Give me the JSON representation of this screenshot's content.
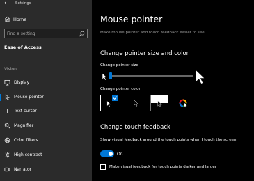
{
  "window": {
    "title": "Settings"
  },
  "sidebar": {
    "home_label": "Home",
    "search_placeholder": "Find a setting",
    "category": "Ease of Access",
    "section": "Vision",
    "items": [
      {
        "label": "Display",
        "icon": "monitor-icon"
      },
      {
        "label": "Mouse pointer",
        "icon": "mouse-pointer-icon",
        "selected": true
      },
      {
        "label": "Text cursor",
        "icon": "text-cursor-icon"
      },
      {
        "label": "Magnifier",
        "icon": "magnifier-icon"
      },
      {
        "label": "Color filters",
        "icon": "color-filters-icon"
      },
      {
        "label": "High contrast",
        "icon": "high-contrast-icon"
      },
      {
        "label": "Narrator",
        "icon": "narrator-icon"
      }
    ]
  },
  "main": {
    "title": "Mouse pointer",
    "description": "Make mouse pointer and touch feedback easier to see.",
    "size_section": {
      "heading": "Change pointer size and color",
      "size_label": "Change pointer size",
      "size_level": 1,
      "size_max": 15,
      "color_label": "Change pointer color",
      "color_options": [
        "white",
        "black",
        "inverted",
        "custom"
      ],
      "selected_color": "white"
    },
    "touch_section": {
      "heading": "Change touch feedback",
      "feedback_label": "Show visual feedback around the touch points when I touch the screen",
      "toggle_state": "On",
      "darker_label": "Make visual feedback for touch points darker and larger",
      "darker_checked": false
    }
  },
  "colors": {
    "accent": "#0078d7",
    "sidebar_bg": "#2b2b2b",
    "main_bg": "#000000"
  }
}
